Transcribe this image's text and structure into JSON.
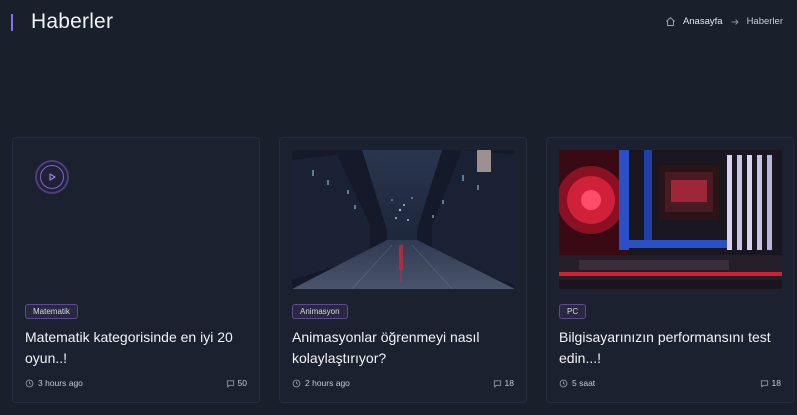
{
  "header": {
    "title": "Haberler",
    "breadcrumb": {
      "home": "Anasayfa",
      "current": "Haberler"
    }
  },
  "accent_color": "#8a6cf0",
  "cards": [
    {
      "tag": "Matematik",
      "title": "Matematik kategorisinde en iyi 20 oyun..!",
      "time": "3 hours ago",
      "comments": "50",
      "media": "video-placeholder"
    },
    {
      "tag": "Animasyon",
      "title": "Animasyonlar öğrenmeyi nasıl kolaylaştırıyor?",
      "time": "2 hours ago",
      "comments": "18",
      "media": "city-street-night-image"
    },
    {
      "tag": "PC",
      "title": "Bilgisayarınızın performansını test edin...!",
      "time": "5 saat",
      "comments": "18",
      "media": "pc-hardware-image"
    }
  ]
}
